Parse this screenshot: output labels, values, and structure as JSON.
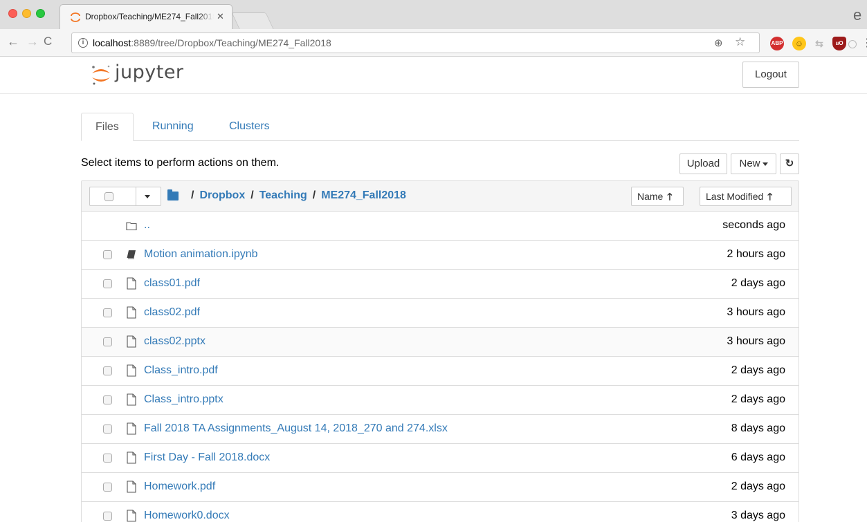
{
  "browser": {
    "tab_title": "Dropbox/Teaching/ME274_Fall2018",
    "url_host": "localhost",
    "url_path": ":8889/tree/Dropbox/Teaching/ME274_Fall2018",
    "ext_abp": "ABP",
    "ext_ublock": "uO"
  },
  "header": {
    "brand": "jupyter",
    "logout_label": "Logout"
  },
  "tabs": [
    {
      "label": "Files"
    },
    {
      "label": "Running"
    },
    {
      "label": "Clusters"
    }
  ],
  "toolbar": {
    "hint": "Select items to perform actions on them.",
    "upload_label": "Upload",
    "new_label": "New",
    "refresh_icon": "refresh-icon"
  },
  "breadcrumb": {
    "items": [
      "Dropbox",
      "Teaching",
      "ME274_Fall2018"
    ]
  },
  "sort": {
    "name_label": "Name",
    "modified_label": "Last Modified"
  },
  "files": [
    {
      "name": "..",
      "time": "seconds ago",
      "icon": "folder-icon"
    },
    {
      "name": "Motion animation.ipynb",
      "time": "2 hours ago",
      "icon": "notebook-icon"
    },
    {
      "name": "class01.pdf",
      "time": "2 days ago",
      "icon": "file-icon"
    },
    {
      "name": "class02.pdf",
      "time": "3 hours ago",
      "icon": "file-icon"
    },
    {
      "name": "class02.pptx",
      "time": "3 hours ago",
      "icon": "file-icon"
    },
    {
      "name": "Class_intro.pdf",
      "time": "2 days ago",
      "icon": "file-icon"
    },
    {
      "name": "Class_intro.pptx",
      "time": "2 days ago",
      "icon": "file-icon"
    },
    {
      "name": "Fall 2018 TA Assignments_August 14, 2018_270 and 274.xlsx",
      "time": "8 days ago",
      "icon": "file-icon"
    },
    {
      "name": "First Day - Fall 2018.docx",
      "time": "6 days ago",
      "icon": "file-icon"
    },
    {
      "name": "Homework.pdf",
      "time": "2 days ago",
      "icon": "file-icon"
    },
    {
      "name": "Homework0.docx",
      "time": "3 days ago",
      "icon": "file-icon"
    }
  ]
}
